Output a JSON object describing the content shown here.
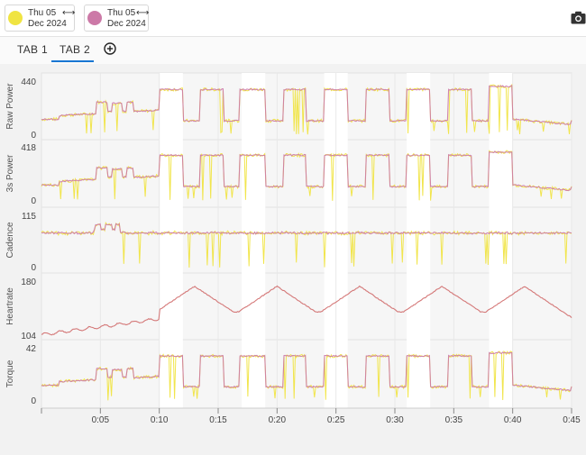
{
  "files": [
    {
      "line1": "Thu 05",
      "line2": "Dec 2024",
      "color": "#f0e442"
    },
    {
      "line1": "Thu 05",
      "line2": "Dec 2024",
      "color": "#cc79a7"
    }
  ],
  "tabs": [
    {
      "label": "TAB 1"
    },
    {
      "label": "TAB 2"
    }
  ],
  "icons": {
    "camera": "camera-icon",
    "add_tab": "add-circle-icon",
    "arrow": "double-arrow-icon"
  },
  "chart_data": {
    "type": "line",
    "x_ticks": [
      "0:05",
      "0:10",
      "0:15",
      "0:20",
      "0:25",
      "0:30",
      "0:35",
      "0:40",
      "0:45"
    ],
    "x_range_min": [
      0,
      45
    ],
    "highlight_intervals_min": [
      [
        10,
        12
      ],
      [
        17,
        19
      ],
      [
        24,
        26
      ],
      [
        31,
        33
      ],
      [
        38,
        40
      ]
    ],
    "series": [
      {
        "color": "#f0e442"
      },
      {
        "color": "#cc79a7"
      }
    ],
    "panels": [
      {
        "ylabel": "Raw Power",
        "ytick_top": "440",
        "ytick_bottom": "0",
        "ylim": [
          0,
          440
        ]
      },
      {
        "ylabel": "3s Power",
        "ytick_top": "418",
        "ytick_bottom": "0",
        "ylim": [
          0,
          418
        ]
      },
      {
        "ylabel": "Cadence",
        "ytick_top": "115",
        "ytick_bottom": "0",
        "ylim": [
          0,
          115
        ]
      },
      {
        "ylabel": "Heartrate",
        "ytick_top": "180",
        "ytick_bottom": "104",
        "ylim": [
          104,
          180
        ]
      },
      {
        "ylabel": "Torque",
        "ytick_top": "42",
        "ytick_bottom": "0",
        "ylim": [
          0,
          42
        ]
      }
    ]
  }
}
